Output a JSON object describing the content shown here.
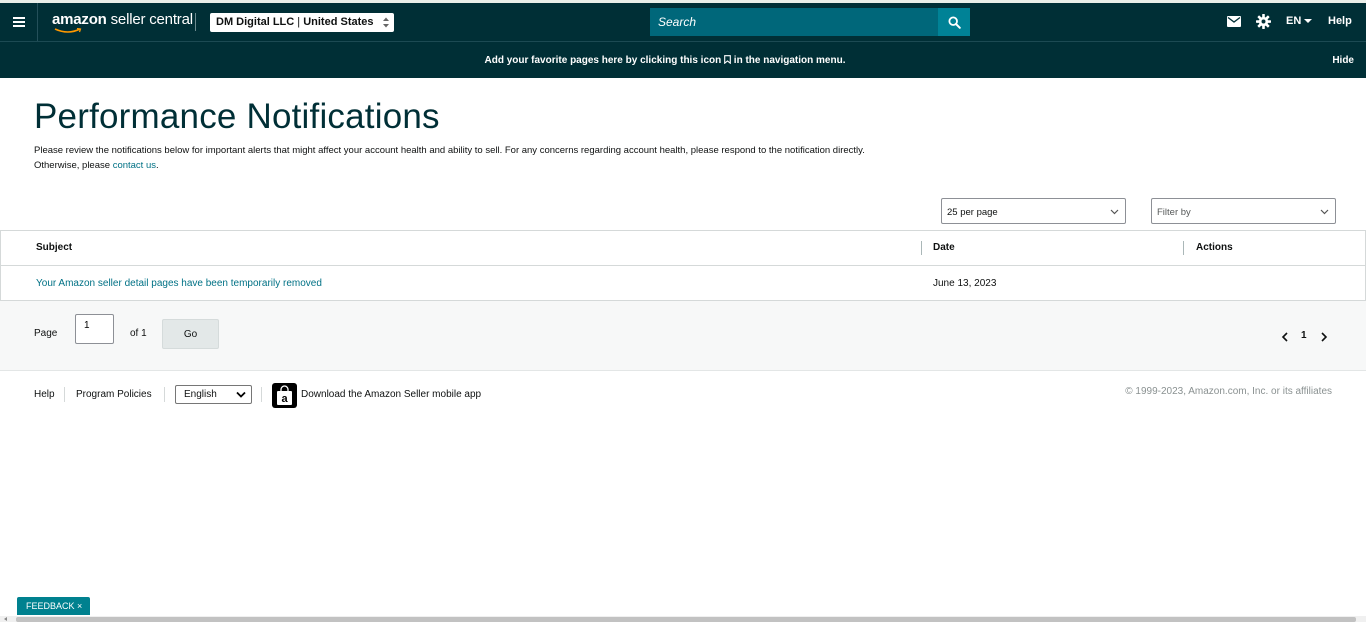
{
  "topbar": {
    "logo_bold": "amazon",
    "logo_rest": " seller central",
    "account_name": "DM Digital LLC",
    "account_sep": " | ",
    "account_region": "United States",
    "search_placeholder": "Search",
    "language": "EN",
    "help": "Help",
    "icons": [
      "menu-icon",
      "search-icon",
      "mail-icon",
      "gear-icon"
    ]
  },
  "favorites_bar": {
    "msg_before": "Add your favorite pages here by clicking this icon",
    "msg_after": "in the navigation menu.",
    "hide": "Hide"
  },
  "main": {
    "title": "Performance Notifications",
    "description": "Please review the notifications below for important alerts that might affect your account health and ability to sell. For any concerns regarding account health, please respond to the notification directly. Otherwise, please ",
    "contact_link": "contact us",
    "description_end": ".",
    "per_page": "25 per page",
    "filter_placeholder": "Filter by"
  },
  "table": {
    "columns": [
      "Subject",
      "Date",
      "Actions"
    ],
    "rows": [
      {
        "subject": "Your Amazon seller detail pages have been temporarily removed",
        "date": "June 13, 2023",
        "actions": ""
      }
    ]
  },
  "pagination": {
    "page_label": "Page",
    "page_value": "1",
    "of_label": "of 1",
    "go": "Go",
    "current": "1"
  },
  "footer": {
    "help": "Help",
    "policies": "Program Policies",
    "language": "English",
    "app": "Download the Amazon Seller mobile app",
    "copyright": "© 1999-2023, Amazon.com, Inc. or its affiliates"
  },
  "feedback": "FEEDBACK ×",
  "colors": {
    "nav_bg": "#002f36",
    "search_bg": "#00677a",
    "search_btn": "#008296",
    "link": "#007185",
    "feedback": "#00818f"
  }
}
